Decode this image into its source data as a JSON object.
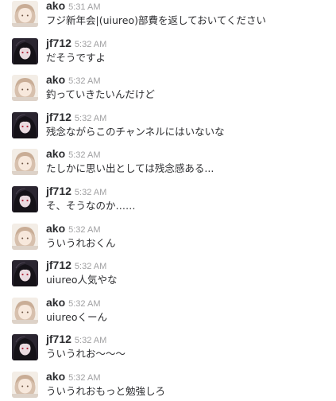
{
  "chat": {
    "messages": [
      {
        "user": "ako",
        "time": "5:31 AM",
        "avatar": "ako-avatar",
        "text": "フジ新年会|(uiureo)部費を返しておいてください"
      },
      {
        "user": "jf712",
        "time": "5:32 AM",
        "avatar": "jf712-avatar",
        "text": "だそうですよ"
      },
      {
        "user": "ako",
        "time": "5:32 AM",
        "avatar": "ako-avatar",
        "text": "釣っていきたいんだけど"
      },
      {
        "user": "jf712",
        "time": "5:32 AM",
        "avatar": "jf712-avatar",
        "text": "残念ながらこのチャンネルにはいないな"
      },
      {
        "user": "ako",
        "time": "5:32 AM",
        "avatar": "ako-avatar",
        "text": "たしかに思い出としては残念感ある..."
      },
      {
        "user": "jf712",
        "time": "5:32 AM",
        "avatar": "jf712-avatar",
        "text": "そ、そうなのか……"
      },
      {
        "user": "ako",
        "time": "5:32 AM",
        "avatar": "ako-avatar",
        "text": "ういうれおくん"
      },
      {
        "user": "jf712",
        "time": "5:32 AM",
        "avatar": "jf712-avatar",
        "text": "uiureo人気やな"
      },
      {
        "user": "ako",
        "time": "5:32 AM",
        "avatar": "ako-avatar",
        "text": "uiureoくーん"
      },
      {
        "user": "jf712",
        "time": "5:32 AM",
        "avatar": "jf712-avatar",
        "text": "ういうれお～～～"
      },
      {
        "user": "ako",
        "time": "5:32 AM",
        "avatar": "ako-avatar",
        "text": "ういうれおもっと勉強しろ"
      }
    ]
  },
  "colors": {
    "username": "#2c2d30",
    "timestamp": "#a0a0a2",
    "message_text": "#2c2d30"
  }
}
